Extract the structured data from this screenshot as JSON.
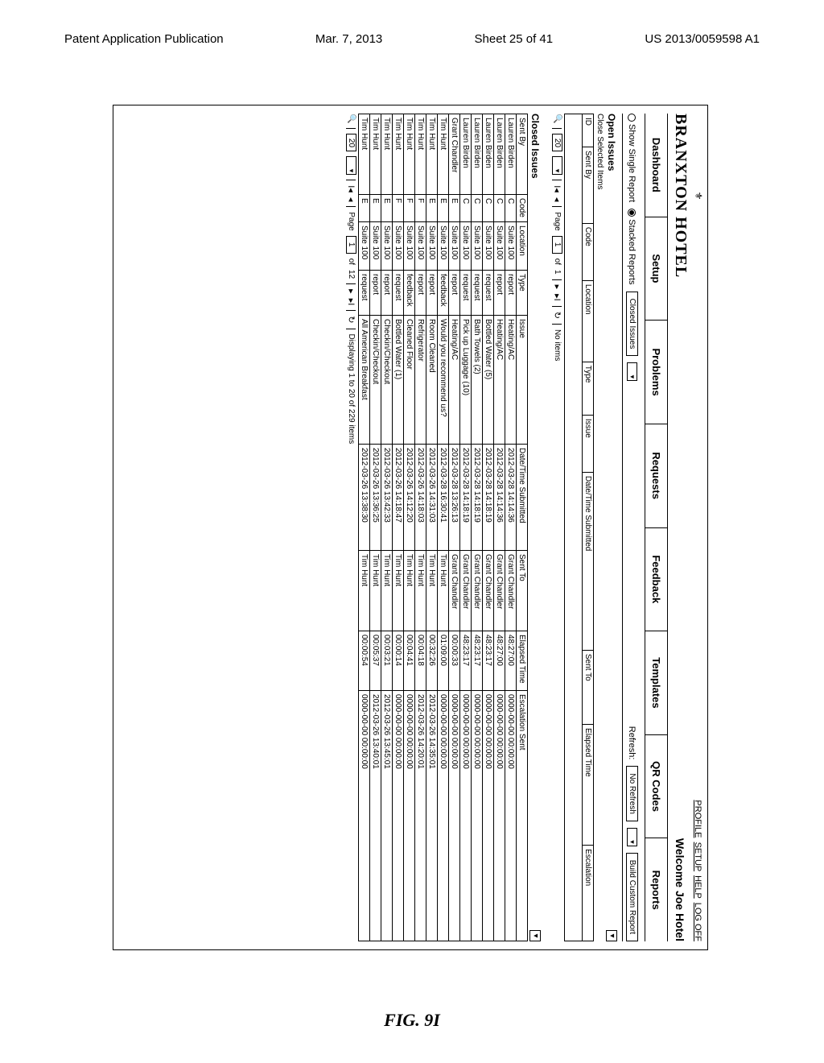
{
  "page": {
    "pub_left": "Patent Application Publication",
    "pub_date": "Mar. 7, 2013",
    "sheet": "Sheet 25 of 41",
    "pub_num": "US 2013/0059598 A1",
    "figure_label": "FIG. 9I"
  },
  "header": {
    "brand": "BRANXTON HOTEL",
    "links": {
      "profile": "PROFILE",
      "setup": "SETUP",
      "help": "HELP",
      "logoff": "LOG OFF"
    },
    "welcome": "Welcome Joe Hotel"
  },
  "tabs": [
    "Dashboard",
    "Setup",
    "Problems",
    "Requests",
    "Feedback",
    "Templates",
    "QR Codes",
    "Reports"
  ],
  "controls": {
    "single_report": "Show Single Report",
    "stacked_reports": "Stacked Reports",
    "closed_issues_btn": "Closed Issues",
    "refresh_label": "Refresh:",
    "refresh_value": "No Refresh",
    "build_custom": "Build Custom Report"
  },
  "open": {
    "title": "Open Issues",
    "close_selected": "Close Selected Items",
    "cols": [
      "ID",
      "Sent By",
      "Code",
      "Location",
      "Type",
      "Issue",
      "Date/Time Submitted",
      "Sent To",
      "Elapsed Time",
      "Escalation"
    ],
    "pager": {
      "size": "20",
      "page": "1",
      "total_pages": "1",
      "status": "No items"
    }
  },
  "closed": {
    "title": "Closed Issues",
    "cols": [
      "Sent By",
      "Code",
      "Location",
      "Type",
      "Issue",
      "Date/Time Submitted",
      "Sent To",
      "Elapsed Time",
      "Escalation Sent"
    ],
    "rows": [
      [
        "Lauren Birden",
        "C",
        "Suite 100",
        "report",
        "Heating/AC",
        "2012-03-28 14:14:36",
        "Grant Chandler",
        "48:27:00",
        "0000-00-00 00:00:00"
      ],
      [
        "Lauren Birden",
        "C",
        "Suite 100",
        "report",
        "Heating/AC",
        "2012-03-28 14:14:36",
        "Grant Chandler",
        "48:27:00",
        "0000-00-00 00:00:00"
      ],
      [
        "Lauren Birden",
        "C",
        "Suite 100",
        "request",
        "Bottled Water (5)",
        "2012-03-28 14:18:19",
        "Grant Chandler",
        "48:23:17",
        "0000-00-00 00:00:00"
      ],
      [
        "Lauren Birden",
        "C",
        "Suite 100",
        "request",
        "Bath Towels (2)",
        "2012-03-28 14:18:19",
        "Grant Chandler",
        "48:23:17",
        "0000-00-00 00:00:00"
      ],
      [
        "Lauren Birden",
        "C",
        "Suite 100",
        "request",
        "Pick up Luggage (10)",
        "2012-03-28 14:18:19",
        "Grant Chandler",
        "48:23:17",
        "0000-00-00 00:00:00"
      ],
      [
        "Grant Chandler",
        "E",
        "Suite 100",
        "report",
        "Heating/AC",
        "2012-03-28 13:26:13",
        "Grant Chandler",
        "00:00:33",
        "0000-00-00 00:00:00"
      ],
      [
        "Tim Hunt",
        "E",
        "Suite 100",
        "feedback",
        "Would you recommend us?",
        "2012-03-28 16:30:41",
        "Tim Hunt",
        "01:09:00",
        "0000-00-00 00:00:00"
      ],
      [
        "Tim Hunt",
        "E",
        "Suite 100",
        "report",
        "Room Cleaned",
        "2012-03-26 14:31:03",
        "Tim Hunt",
        "00:32:26",
        "2012-03-26 14:35:01"
      ],
      [
        "Tim Hunt",
        "F",
        "Suite 100",
        "report",
        "Refrigerator",
        "2012-03-26 14:18:03",
        "Tim Hunt",
        "00:04:18",
        "2012-03-26 14:20:01"
      ],
      [
        "Tim Hunt",
        "F",
        "Suite 100",
        "feedback",
        "Cleaned Floor",
        "2012-03-26 14:12:20",
        "Tim Hunt",
        "00:04:41",
        "0000-00-00 00:00:00"
      ],
      [
        "Tim Hunt",
        "F",
        "Suite 100",
        "request",
        "Bottled Water (1)",
        "2012-03-26 14:18:47",
        "Tim Hunt",
        "00:00:14",
        "0000-00-00 00:00:00"
      ],
      [
        "Tim Hunt",
        "E",
        "Suite 100",
        "report",
        "Checkin/Checkout",
        "2012-03-26 13:42:33",
        "Tim Hunt",
        "00:03:21",
        "2012-03-26 13:45:01"
      ],
      [
        "Tim Hunt",
        "E",
        "Suite 100",
        "report",
        "Checkin/Checkout",
        "2012-03-26 13:36:25",
        "Tim Hunt",
        "00:05:37",
        "2012-03-26 13:40:01"
      ],
      [
        "Tim Hunt",
        "E",
        "Suite 100",
        "request",
        "All American Breakfast",
        "2012-03-26 13:38:30",
        "Tim Hunt",
        "00:00:54",
        "0000-00-00 00:00:00"
      ]
    ],
    "pager": {
      "size": "20",
      "page": "1",
      "total_pages": "12",
      "status": "Displaying 1 to 20 of 229 items"
    }
  }
}
